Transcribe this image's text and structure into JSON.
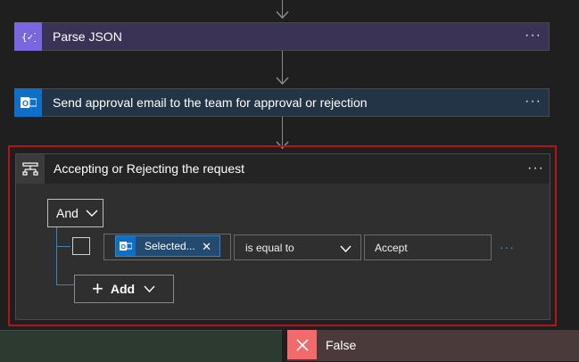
{
  "parse_card": {
    "title": "Parse JSON",
    "icon": "braces-icon",
    "more": "···"
  },
  "email_card": {
    "title": "Send approval email to the team for approval or rejection",
    "icon": "outlook-icon",
    "more": "···"
  },
  "condition": {
    "title": "Accepting or Rejecting the request",
    "icon": "condition-icon",
    "more": "···",
    "group_operator": "And",
    "row": {
      "left_token": "Selected...",
      "operator": "is equal to",
      "right_value": "Accept",
      "more": "···"
    },
    "add_label": "Add"
  },
  "branches": {
    "no_label": "False"
  },
  "colors": {
    "highlight": "#b3141a",
    "parse": "#7a66dd",
    "outlook": "#0f6fc5",
    "false": "#f06b6b"
  }
}
